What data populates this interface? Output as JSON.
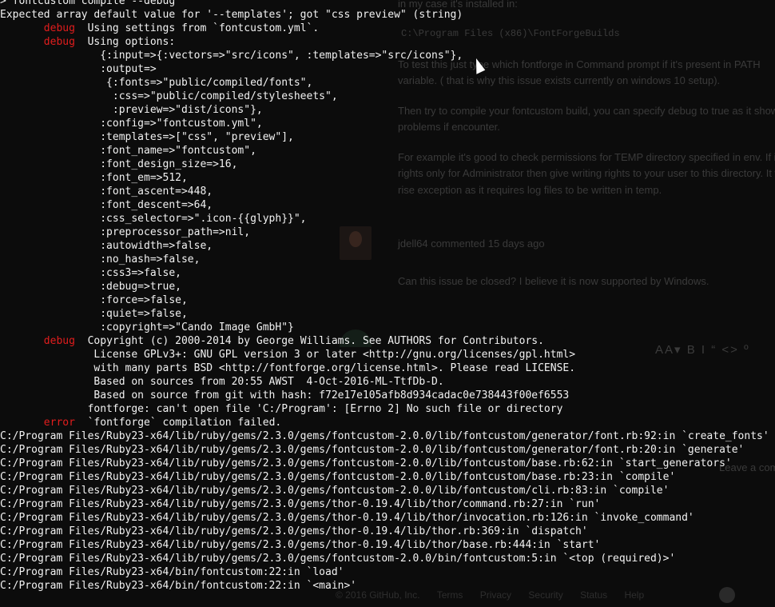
{
  "background_page": {
    "lines": [
      "in my case it's installed in:",
      "C:\\Program Files (x86)\\FontForgeBuilds",
      "To test this just type  which fontforge  in Command prompt if it's present in PATH",
      "variable. ( that is why this issue exists currently on windows 10 setup).",
      "Then try to compile your fontcustom build, you can specify debug to true as it shows you",
      "problems if encounter.",
      "For example it's good to check permissions for TEMP directory specified in env. If it has",
      "rights only for Administrator then give writing rights to your user to this directory. It will",
      "rise exception as it requires log files to be written in temp.",
      "jdell64 commented 15 days ago",
      "Can this issue be closed? I believe it is now supported by Windows.",
      "Leave a comment"
    ],
    "toolbar": "AA▾ B I   “ <> º",
    "footer": [
      "© 2016 GitHub, Inc.",
      "Terms",
      "Privacy",
      "Security",
      "Status",
      "Help"
    ]
  },
  "console": {
    "lines": [
      {
        "text": "> fontcustom compile --debug"
      },
      {
        "text": "Expected array default value for '--templates'; got \"css preview\" (string)"
      },
      {
        "indent": "       ",
        "label": "debug",
        "text": "  Using settings from `fontcustom.yml`."
      },
      {
        "indent": "       ",
        "label": "debug",
        "text": "  Using options:"
      },
      {
        "text": "                {:input=>{:vectors=>\"src/icons\", :templates=>\"src/icons\"},"
      },
      {
        "text": "                :output=>"
      },
      {
        "text": "                 {:fonts=>\"public/compiled/fonts\","
      },
      {
        "text": "                  :css=>\"public/compiled/stylesheets\","
      },
      {
        "text": "                  :preview=>\"dist/icons\"},"
      },
      {
        "text": "                :config=>\"fontcustom.yml\","
      },
      {
        "text": "                :templates=>[\"css\", \"preview\"],"
      },
      {
        "text": "                :font_name=>\"fontcustom\","
      },
      {
        "text": "                :font_design_size=>16,"
      },
      {
        "text": "                :font_em=>512,"
      },
      {
        "text": "                :font_ascent=>448,"
      },
      {
        "text": "                :font_descent=>64,"
      },
      {
        "text": "                :css_selector=>\".icon-{{glyph}}\","
      },
      {
        "text": "                :preprocessor_path=>nil,"
      },
      {
        "text": "                :autowidth=>false,"
      },
      {
        "text": "                :no_hash=>false,"
      },
      {
        "text": "                :css3=>false,"
      },
      {
        "text": "                :debug=>true,"
      },
      {
        "text": "                :force=>false,"
      },
      {
        "text": "                :quiet=>false,"
      },
      {
        "text": "                :copyright=>\"Cando Image GmbH\"}"
      },
      {
        "indent": "       ",
        "label": "debug",
        "text": "  Copyright (c) 2000-2014 by George Williams. See AUTHORS for Contributors."
      },
      {
        "text": "               License GPLv3+: GNU GPL version 3 or later <http://gnu.org/licenses/gpl.html>"
      },
      {
        "text": "               with many parts BSD <http://fontforge.org/license.html>. Please read LICENSE."
      },
      {
        "text": "               Based on sources from 20:55 AWST  4-Oct-2016-ML-TtfDb-D."
      },
      {
        "text": "               Based on source from git with hash: f72e17e105afb8d934cadac0e738443f00ef6553"
      },
      {
        "text": "              fontforge: can't open file 'C:/Program': [Errno 2] No such file or directory"
      },
      {
        "indent": "       ",
        "label": "error",
        "text": "  `fontforge` compilation failed."
      },
      {
        "text": "C:/Program Files/Ruby23-x64/lib/ruby/gems/2.3.0/gems/fontcustom-2.0.0/lib/fontcustom/generator/font.rb:92:in `create_fonts'"
      },
      {
        "text": "C:/Program Files/Ruby23-x64/lib/ruby/gems/2.3.0/gems/fontcustom-2.0.0/lib/fontcustom/generator/font.rb:20:in `generate'"
      },
      {
        "text": "C:/Program Files/Ruby23-x64/lib/ruby/gems/2.3.0/gems/fontcustom-2.0.0/lib/fontcustom/base.rb:62:in `start_generators'"
      },
      {
        "text": "C:/Program Files/Ruby23-x64/lib/ruby/gems/2.3.0/gems/fontcustom-2.0.0/lib/fontcustom/base.rb:23:in `compile'"
      },
      {
        "text": "C:/Program Files/Ruby23-x64/lib/ruby/gems/2.3.0/gems/fontcustom-2.0.0/lib/fontcustom/cli.rb:83:in `compile'"
      },
      {
        "text": "C:/Program Files/Ruby23-x64/lib/ruby/gems/2.3.0/gems/thor-0.19.4/lib/thor/command.rb:27:in `run'"
      },
      {
        "text": "C:/Program Files/Ruby23-x64/lib/ruby/gems/2.3.0/gems/thor-0.19.4/lib/thor/invocation.rb:126:in `invoke_command'"
      },
      {
        "text": "C:/Program Files/Ruby23-x64/lib/ruby/gems/2.3.0/gems/thor-0.19.4/lib/thor.rb:369:in `dispatch'"
      },
      {
        "text": "C:/Program Files/Ruby23-x64/lib/ruby/gems/2.3.0/gems/thor-0.19.4/lib/thor/base.rb:444:in `start'"
      },
      {
        "text": "C:/Program Files/Ruby23-x64/lib/ruby/gems/2.3.0/gems/fontcustom-2.0.0/bin/fontcustom:5:in `<top (required)>'"
      },
      {
        "text": "C:/Program Files/Ruby23-x64/bin/fontcustom:22:in `load'"
      },
      {
        "text": "C:/Program Files/Ruby23-x64/bin/fontcustom:22:in `<main>'"
      }
    ]
  },
  "colors": {
    "console_bg": "#0c0c0c",
    "console_text": "#f2f2f2",
    "label_red": "#e21d1d"
  }
}
